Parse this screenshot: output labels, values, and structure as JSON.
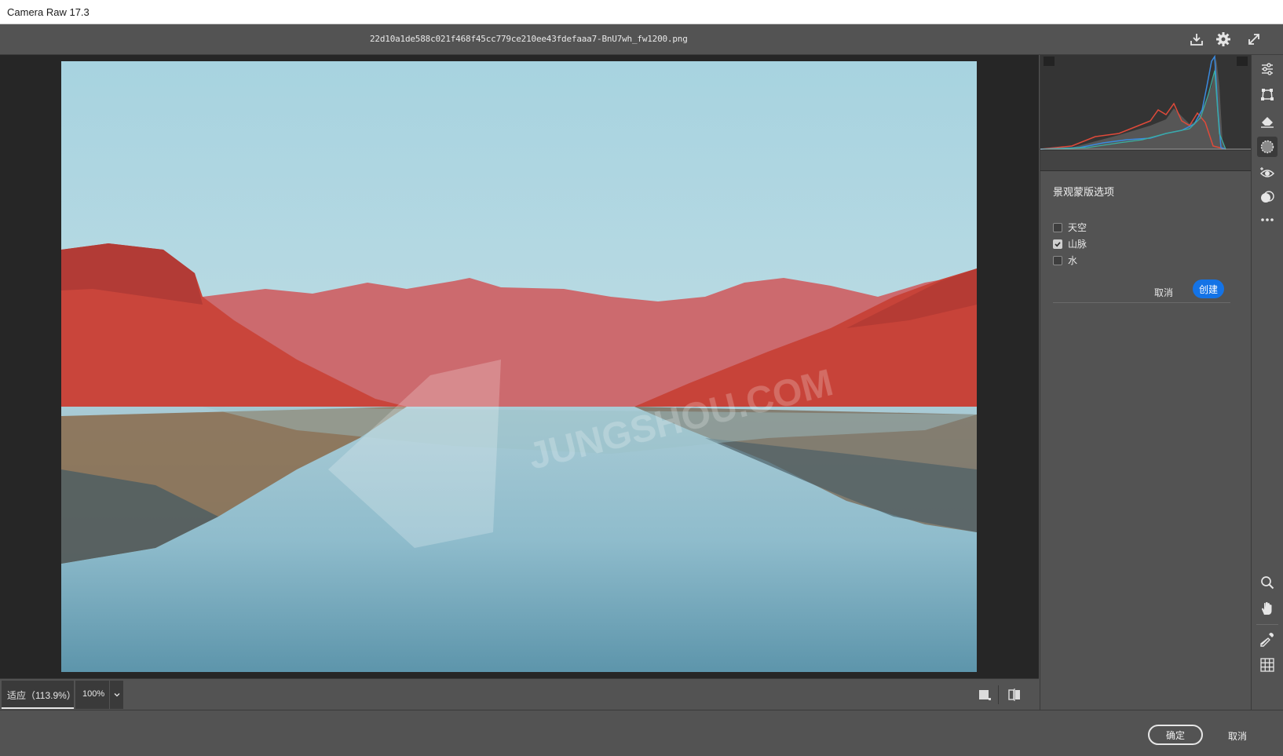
{
  "window": {
    "title": "Camera Raw 17.3"
  },
  "topbar": {
    "filename": "22d10a1de588c021f468f45cc779ce210ee43fdefaaa7-BnU7wh_fw1200.png",
    "icons": [
      "save-icon",
      "gear-icon",
      "fullscreen-icon"
    ]
  },
  "canvas_footer": {
    "zoom_fit_label": "适应（113.9%）",
    "zoom_100_label": "100%",
    "icons": [
      "chevron-down-icon",
      "view-toggle-icon",
      "before-after-icon"
    ]
  },
  "mask_panel": {
    "title": "景观蒙版选项",
    "options": [
      {
        "label": "天空",
        "checked": false
      },
      {
        "label": "山脉",
        "checked": true
      },
      {
        "label": "水",
        "checked": false
      }
    ],
    "cancel_label": "取消",
    "create_label": "创建"
  },
  "toolbar": {
    "tools": [
      "edit-sliders-icon",
      "crop-icon",
      "eraser-icon",
      "masking-icon",
      "redeye-icon",
      "presets-icon",
      "more-icon",
      "zoom-icon",
      "hand-icon",
      "sampler-icon",
      "grid-icon"
    ],
    "active": "masking-icon"
  },
  "bottom": {
    "ok_label": "确定",
    "cancel_label": "取消"
  },
  "colors": {
    "accent": "#1473e6",
    "mask_overlay": "#d9473c",
    "panel": "#535353",
    "canvas_bg": "#262626"
  },
  "watermark": {
    "text": "JUNGSHOU.COM"
  }
}
